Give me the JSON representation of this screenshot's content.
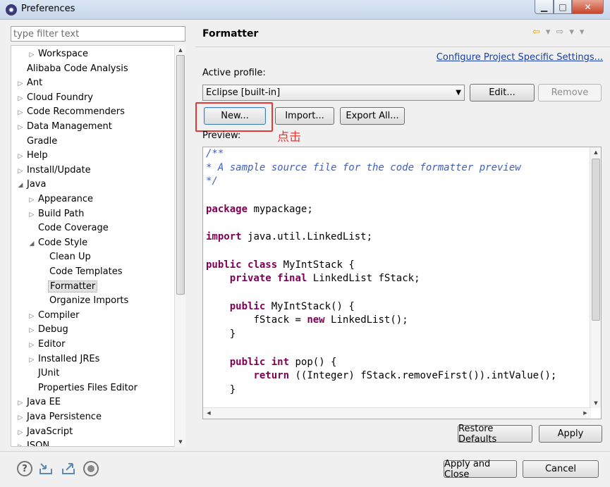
{
  "window": {
    "title": "Preferences",
    "minimize": "▁",
    "maximize": "□",
    "close": "✕"
  },
  "filter": {
    "placeholder": "type filter text"
  },
  "tree": [
    {
      "label": "Workspace",
      "arrow": "▷",
      "level": 1
    },
    {
      "label": "Alibaba Code Analysis",
      "arrow": "",
      "level": 0
    },
    {
      "label": "Ant",
      "arrow": "▷",
      "level": 0
    },
    {
      "label": "Cloud Foundry",
      "arrow": "▷",
      "level": 0
    },
    {
      "label": "Code Recommenders",
      "arrow": "▷",
      "level": 0
    },
    {
      "label": "Data Management",
      "arrow": "▷",
      "level": 0
    },
    {
      "label": "Gradle",
      "arrow": "",
      "level": 0
    },
    {
      "label": "Help",
      "arrow": "▷",
      "level": 0
    },
    {
      "label": "Install/Update",
      "arrow": "▷",
      "level": 0
    },
    {
      "label": "Java",
      "arrow": "◢",
      "level": 0
    },
    {
      "label": "Appearance",
      "arrow": "▷",
      "level": 1
    },
    {
      "label": "Build Path",
      "arrow": "▷",
      "level": 1
    },
    {
      "label": "Code Coverage",
      "arrow": "",
      "level": 1
    },
    {
      "label": "Code Style",
      "arrow": "◢",
      "level": 1
    },
    {
      "label": "Clean Up",
      "arrow": "",
      "level": 2
    },
    {
      "label": "Code Templates",
      "arrow": "",
      "level": 2
    },
    {
      "label": "Formatter",
      "arrow": "",
      "level": 2,
      "selected": true
    },
    {
      "label": "Organize Imports",
      "arrow": "",
      "level": 2
    },
    {
      "label": "Compiler",
      "arrow": "▷",
      "level": 1
    },
    {
      "label": "Debug",
      "arrow": "▷",
      "level": 1
    },
    {
      "label": "Editor",
      "arrow": "▷",
      "level": 1
    },
    {
      "label": "Installed JREs",
      "arrow": "▷",
      "level": 1
    },
    {
      "label": "JUnit",
      "arrow": "",
      "level": 1
    },
    {
      "label": "Properties Files Editor",
      "arrow": "",
      "level": 1
    },
    {
      "label": "Java EE",
      "arrow": "▷",
      "level": 0
    },
    {
      "label": "Java Persistence",
      "arrow": "▷",
      "level": 0
    },
    {
      "label": "JavaScript",
      "arrow": "▷",
      "level": 0
    },
    {
      "label": "JSON",
      "arrow": "▷",
      "level": 0
    }
  ],
  "page": {
    "title": "Formatter",
    "config_link": "Configure Project Specific Settings...",
    "active_profile_label": "Active profile:",
    "profile_value": "Eclipse [built-in]",
    "buttons": {
      "edit": "Edit...",
      "remove": "Remove",
      "new": "New...",
      "import": "Import...",
      "export_all": "Export All...",
      "restore_defaults": "Restore Defaults",
      "apply": "Apply"
    },
    "annotation": "点击",
    "preview_label": "Preview:"
  },
  "preview_code": [
    "/**",
    "* A sample source file for the code formatter preview",
    "*/",
    "",
    "package mypackage;",
    "",
    "import java.util.LinkedList;",
    "",
    "public class MyIntStack {",
    "    private final LinkedList fStack;",
    "",
    "    public MyIntStack() {",
    "        fStack = new LinkedList();",
    "    }",
    "",
    "    public int pop() {",
    "        return ((Integer) fStack.removeFirst()).intValue();",
    "    }"
  ],
  "footer": {
    "apply_and_close": "Apply and Close",
    "cancel": "Cancel"
  },
  "colors": {
    "annotation": "#e53935",
    "link": "#1a3ea6",
    "keyword": "#7f0055",
    "comment": "#3f5fbf"
  }
}
